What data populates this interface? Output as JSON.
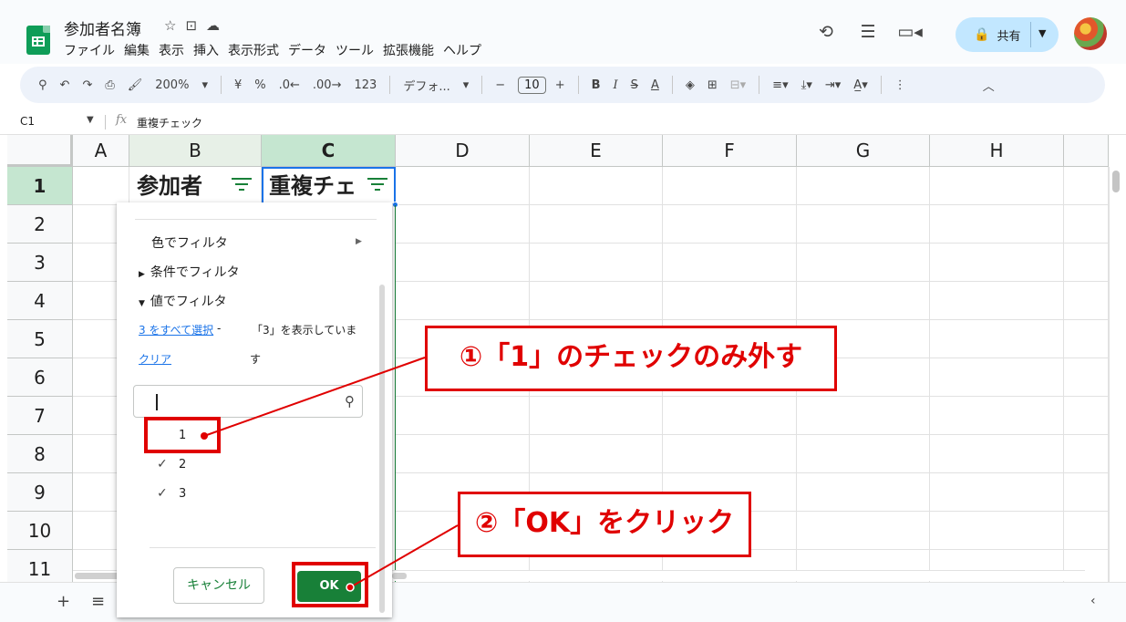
{
  "app": {
    "doc_title": "参加者名簿",
    "menu": [
      "ファイル",
      "編集",
      "表示",
      "挿入",
      "表示形式",
      "データ",
      "ツール",
      "拡張機能",
      "ヘルプ"
    ],
    "share_label": "共有"
  },
  "toolbar": {
    "zoom": "200%",
    "currency": "¥",
    "percent": "%",
    "dec_decrease": ".0←",
    "dec_increase": ".00→",
    "number_format": "123",
    "font": "デフォ...",
    "font_size": "10",
    "bold": "B",
    "italic": "I",
    "strike": "S",
    "text_color": "A"
  },
  "formula_bar": {
    "cell_ref": "C1",
    "fx": "fx",
    "content": "重複チェック"
  },
  "grid": {
    "columns": [
      "A",
      "B",
      "C",
      "D",
      "E",
      "F",
      "G",
      "H"
    ],
    "rows": [
      "1",
      "2",
      "3",
      "4",
      "5",
      "6",
      "7",
      "8",
      "9",
      "10",
      "11"
    ],
    "header_b": "参加者",
    "header_c": "重複チェ"
  },
  "filter_panel": {
    "filter_by_color": "色でフィルタ",
    "filter_by_condition": "条件でフィルタ",
    "filter_by_values": "値でフィルタ",
    "select_all": "3 をすべて選択",
    "select_all_dash": "-",
    "clear": "クリア",
    "showing_note_1": "「3」を表示していま",
    "showing_note_2": "す",
    "values": [
      {
        "label": "1",
        "checked": false
      },
      {
        "label": "2",
        "checked": true
      },
      {
        "label": "3",
        "checked": true
      }
    ],
    "cancel": "キャンセル",
    "ok": "OK"
  },
  "annotations": {
    "step1": "①「1」のチェックのみ外す",
    "step2": "②「OK」をクリック",
    "color": "#e00000"
  },
  "colors": {
    "accent_green": "#188038",
    "selection_blue": "#1a73e8",
    "share_bg": "#c2e7ff"
  }
}
